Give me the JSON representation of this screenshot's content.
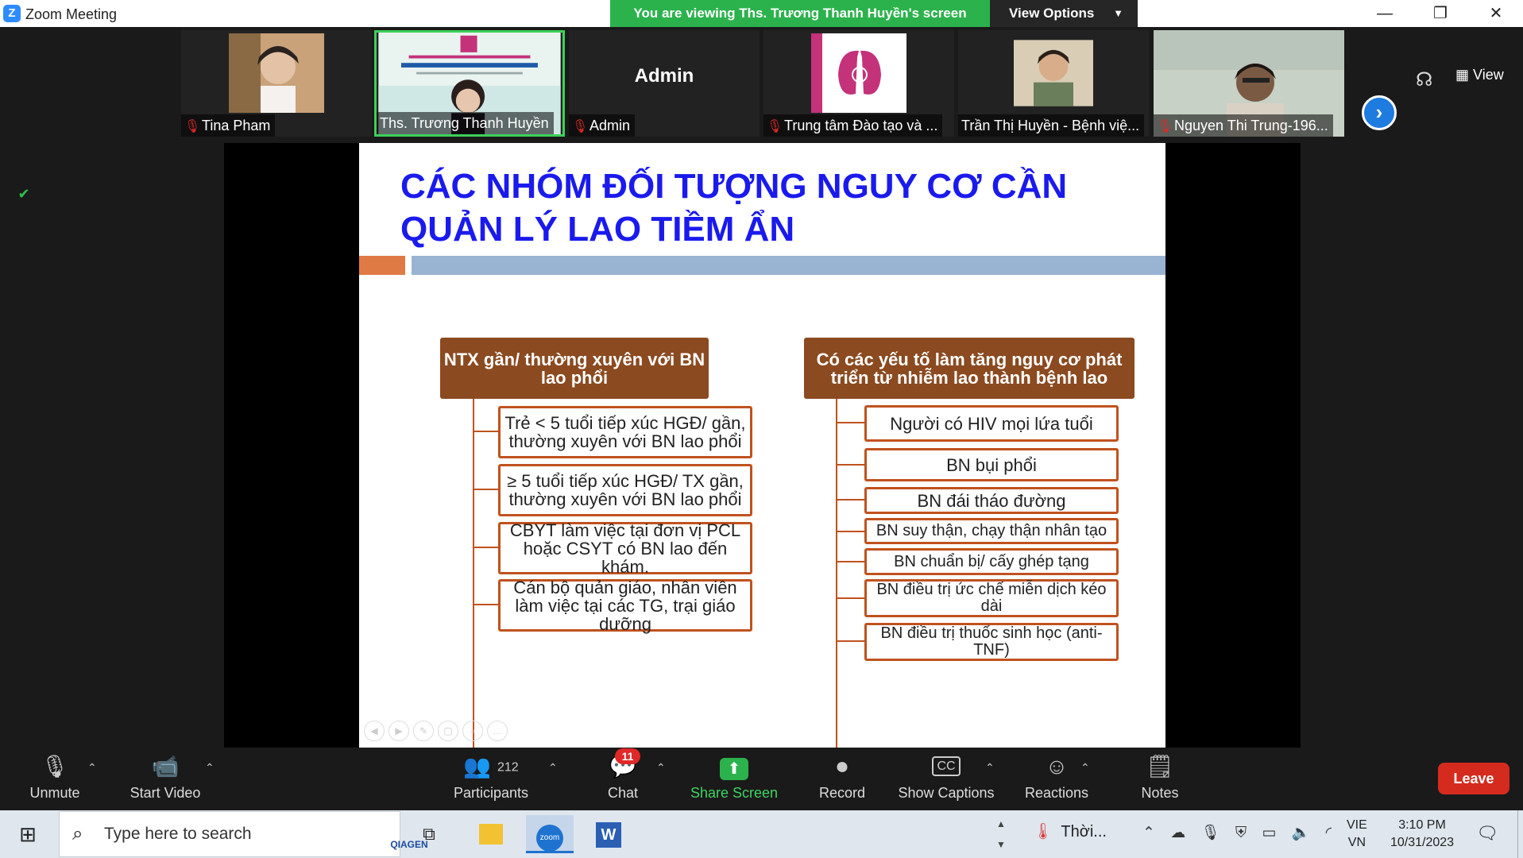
{
  "window": {
    "title": "Zoom Meeting",
    "viewing_banner": "You are viewing Ths. Trương Thanh Huyền's screen",
    "view_options": "View Options"
  },
  "participants_strip": [
    {
      "name": "Tina Pham",
      "muted": true
    },
    {
      "name": "Ths. Trương Thanh Huyền",
      "muted": false,
      "active": true
    },
    {
      "name": "Admin",
      "muted": true,
      "display_name": "Admin"
    },
    {
      "name": "Trung tâm Đào tạo và ...",
      "muted": true
    },
    {
      "name": "Trần Thị Huyền - Bệnh việ...",
      "muted": false
    },
    {
      "name": "Nguyen Thi Trung-196...",
      "muted": true
    }
  ],
  "top_right": {
    "view_label": "View"
  },
  "slide": {
    "title_line1": "CÁC NHÓM ĐỐI TƯỢNG NGUY CƠ CẦN",
    "title_line2": "QUẢN LÝ LAO TIỀM ẨN",
    "left": {
      "header": "NTX gần/ thường xuyên với BN lao phổi",
      "items": [
        "Trẻ < 5 tuổi tiếp xúc HGĐ/ gần, thường xuyên với BN lao phổi",
        "≥ 5 tuổi tiếp xúc HGĐ/ TX gần, thường xuyên với BN lao phổi",
        "CBYT làm việc tại đơn vị PCL hoặc CSYT có BN lao đến khám.",
        "Cán bộ quản giáo, nhân viên làm việc tại các TG, trại giáo dưỡng"
      ]
    },
    "right": {
      "header": "Có các yếu tố làm tăng nguy cơ phát triển từ nhiễm lao thành bệnh lao",
      "items": [
        "Người có HIV mọi lứa tuổi",
        "BN bụi phổi",
        "BN đái tháo đường",
        "BN suy thận, chạy thận nhân tạo",
        "BN chuẩn bị/ cấy ghép tạng",
        "BN điều trị ức chế miễn dịch kéo dài",
        "BN điều trị thuốc sinh học (anti-TNF)"
      ]
    }
  },
  "controls": {
    "unmute": "Unmute",
    "start_video": "Start Video",
    "participants": "Participants",
    "participants_count": "212",
    "chat": "Chat",
    "chat_badge": "11",
    "share_screen": "Share Screen",
    "record": "Record",
    "show_captions": "Show Captions",
    "reactions": "Reactions",
    "notes": "Notes",
    "leave": "Leave"
  },
  "taskbar": {
    "search_placeholder": "Type here to search",
    "qiagen": "QIAGEN",
    "weather": "Thời...",
    "lang_top": "VIE",
    "lang_bottom": "VN",
    "time": "3:10 PM",
    "date": "10/31/2023"
  },
  "colors": {
    "banner_green": "#2bb24c",
    "slide_title_blue": "#1a1aee",
    "header_brown": "#8b4a20",
    "border_orange": "#c0521e",
    "leave_red": "#d52b1e"
  }
}
